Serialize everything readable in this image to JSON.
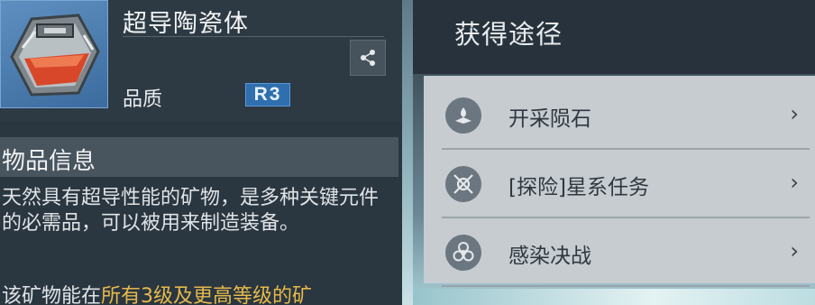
{
  "item": {
    "name": "超导陶瓷体",
    "quality_label": "品质",
    "quality_grade": "R3"
  },
  "info": {
    "title": "物品信息",
    "description": "天然具有超导性能的矿物，是多种关键元件的必需品，可以被用来制造装备。",
    "line2_prefix": "该矿物能在",
    "line2_highlight": "所有3级及更高等级的矿"
  },
  "sources": {
    "title": "获得途径",
    "items": [
      {
        "label": "开采陨石",
        "icon": "mining-icon"
      },
      {
        "label": "[探险]星系任务",
        "icon": "exploration-icon"
      },
      {
        "label": "感染决战",
        "icon": "biohazard-icon"
      }
    ],
    "chevron": "›"
  },
  "colors": {
    "quality_badge": "#2f6fad",
    "highlight": "#e6b94a",
    "list_background": "#c6ccd0"
  }
}
